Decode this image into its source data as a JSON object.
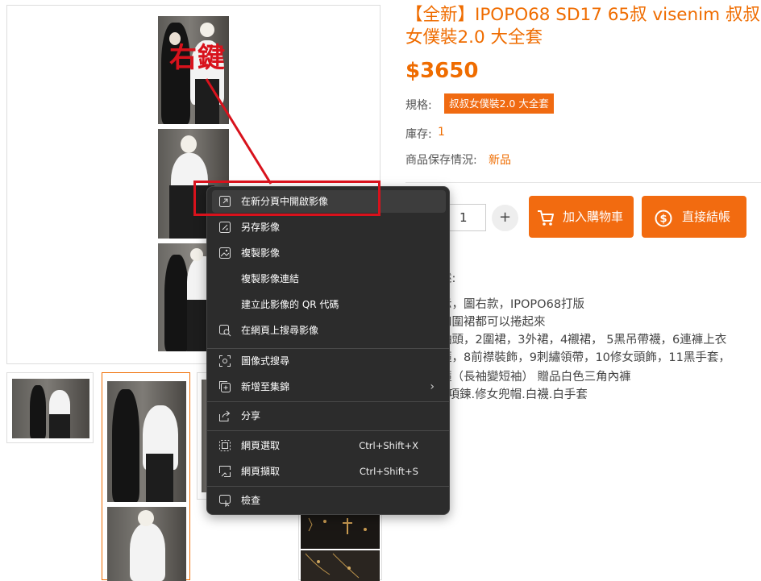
{
  "product": {
    "title_line1": "【全新】IPOPO68 SD17 65叔 visenim 叔叔",
    "title_line2": "女僕裝2.0 大全套",
    "price": "$3650",
    "spec_label": "規格:",
    "spec_value": "叔叔女僕裝2.0 大全套",
    "stock_label": "庫存:",
    "stock_value": "1",
    "condition_label": "商品保存情況:",
    "condition_value": "新品",
    "quantity": "1",
    "qty_plus": "+",
    "add_to_cart": "加入購物車",
    "buy_now": "直接結帳"
  },
  "description": {
    "heading": "述:",
    "lines": [
      "示，圖右款，IPOPO68打版",
      "和圍裙都可以捲起來",
      "袖頭，2圍裙，3外裙，4襯裙，  5黑吊帶襪，6連褲上衣",
      "箍，8前襟裝飾，9刺繡領帶，10修女頭飾，11黑手套，",
      "箍（長袖變短袖） 贈品白色三角內褲",
      ": 項鍊.修女兜帽.白襪.白手套"
    ]
  },
  "annotation": {
    "text": "右鍵",
    "color": "#d8121c"
  },
  "context_menu": {
    "items": [
      {
        "label": "在新分頁中開啟影像",
        "icon": "open-in-new-tab-icon"
      },
      {
        "label": "另存影像",
        "icon": "save-image-icon"
      },
      {
        "label": "複製影像",
        "icon": "copy-image-icon"
      },
      {
        "label": "複製影像連結",
        "icon": ""
      },
      {
        "label": "建立此影像的 QR 代碼",
        "icon": ""
      },
      {
        "label": "在網頁上搜尋影像",
        "icon": "image-search-icon"
      },
      {
        "label": "圖像式搜尋",
        "icon": "visual-search-icon"
      },
      {
        "label": "新增至集錦",
        "icon": "add-to-collections-icon"
      },
      {
        "label": "分享",
        "icon": "share-icon"
      },
      {
        "label": "網頁選取",
        "icon": "web-select-icon",
        "shortcut": "Ctrl+Shift+X"
      },
      {
        "label": "網頁擷取",
        "icon": "web-capture-icon",
        "shortcut": "Ctrl+Shift+S"
      },
      {
        "label": "檢查",
        "icon": "inspect-icon"
      }
    ]
  },
  "colors": {
    "accent": "#ef6c00",
    "menu_bg": "#2c2c2c",
    "annotation": "#d8121c"
  }
}
